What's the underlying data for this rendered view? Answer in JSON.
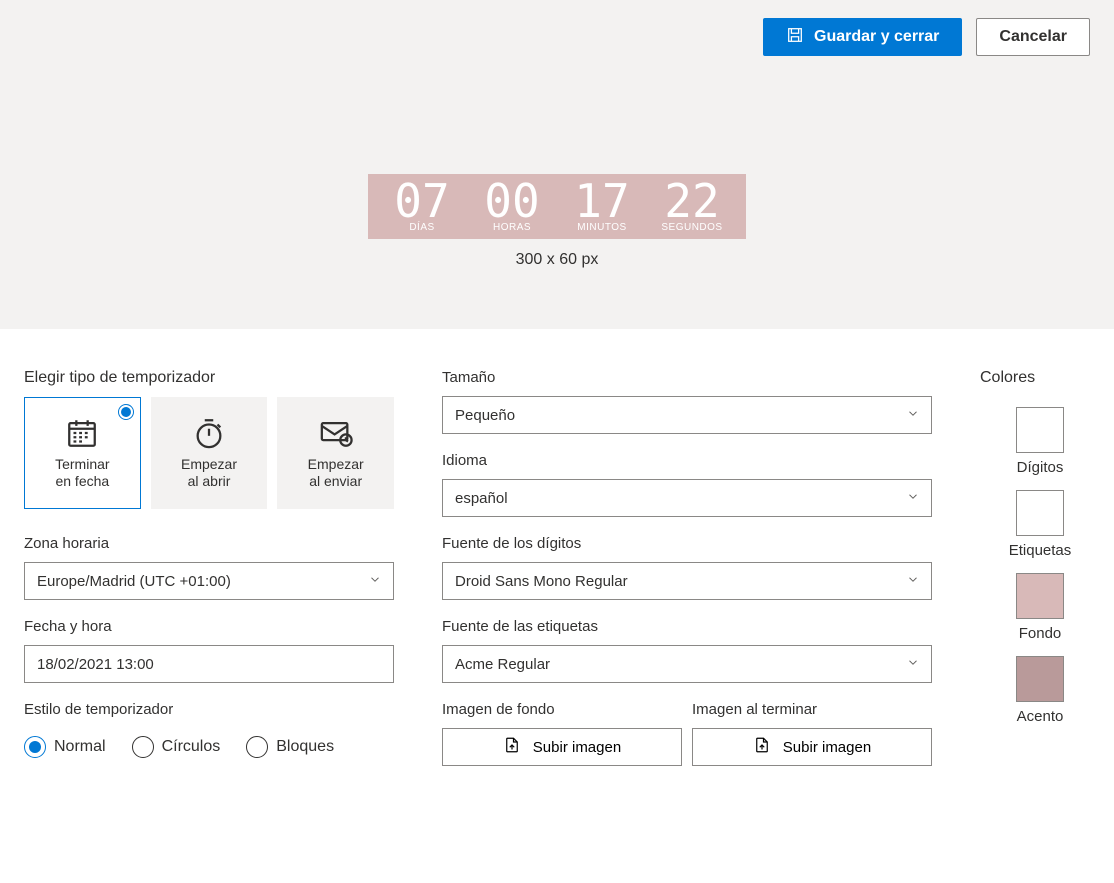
{
  "toolbar": {
    "save_label": "Guardar y cerrar",
    "cancel_label": "Cancelar"
  },
  "preview": {
    "segments": [
      {
        "value": "07",
        "label": "DÍAS"
      },
      {
        "value": "00",
        "label": "HORAS"
      },
      {
        "value": "17",
        "label": "MINUTOS"
      },
      {
        "value": "22",
        "label": "SEGUNDOS"
      }
    ],
    "caption": "300 x 60 px"
  },
  "left": {
    "type_label": "Elegir tipo de temporizador",
    "tiles": [
      {
        "text": "Terminar\nen fecha",
        "selected": true
      },
      {
        "text": "Empezar\nal abrir",
        "selected": false
      },
      {
        "text": "Empezar\nal enviar",
        "selected": false
      }
    ],
    "timezone_label": "Zona horaria",
    "timezone_value": "Europe/Madrid (UTC +01:00)",
    "datetime_label": "Fecha y hora",
    "datetime_value": "18/02/2021 13:00",
    "style_label": "Estilo de temporizador",
    "style_options": [
      {
        "label": "Normal",
        "selected": true
      },
      {
        "label": "Círculos",
        "selected": false
      },
      {
        "label": "Bloques",
        "selected": false
      }
    ]
  },
  "mid": {
    "size_label": "Tamaño",
    "size_value": "Pequeño",
    "lang_label": "Idioma",
    "lang_value": "español",
    "digitfont_label": "Fuente de los dígitos",
    "digitfont_value": "Droid Sans Mono Regular",
    "labelfont_label": "Fuente de las etiquetas",
    "labelfont_value": "Acme Regular",
    "bgimg_label": "Imagen de fondo",
    "endimg_label": "Imagen al terminar",
    "upload_label": "Subir imagen"
  },
  "colors": {
    "title": "Colores",
    "items": [
      {
        "label": "Dígitos",
        "hex": "#ffffff"
      },
      {
        "label": "Etiquetas",
        "hex": "#ffffff"
      },
      {
        "label": "Fondo",
        "hex": "#d8b9b8"
      },
      {
        "label": "Acento",
        "hex": "#b99a9a"
      }
    ]
  }
}
